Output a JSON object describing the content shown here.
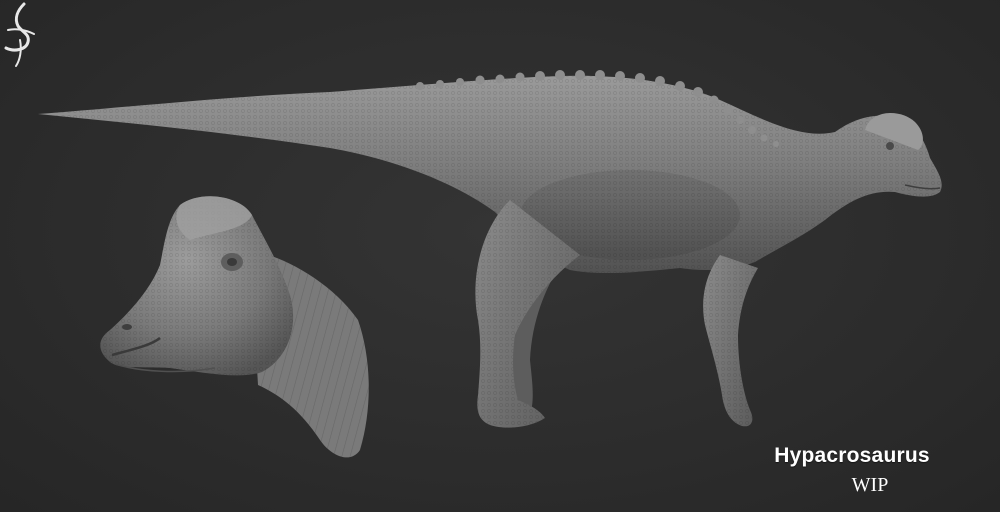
{
  "caption": {
    "title": "Hypacrosaurus",
    "subtitle": "WIP"
  },
  "colors": {
    "background": "#2d2d2d",
    "sculpt_light": "#8a8a8a",
    "sculpt_mid": "#6f6f6f",
    "sculpt_dark": "#4f4f4f",
    "text": "#ffffff"
  },
  "icons": {
    "artist_logo": "stylized-signature-logo"
  }
}
